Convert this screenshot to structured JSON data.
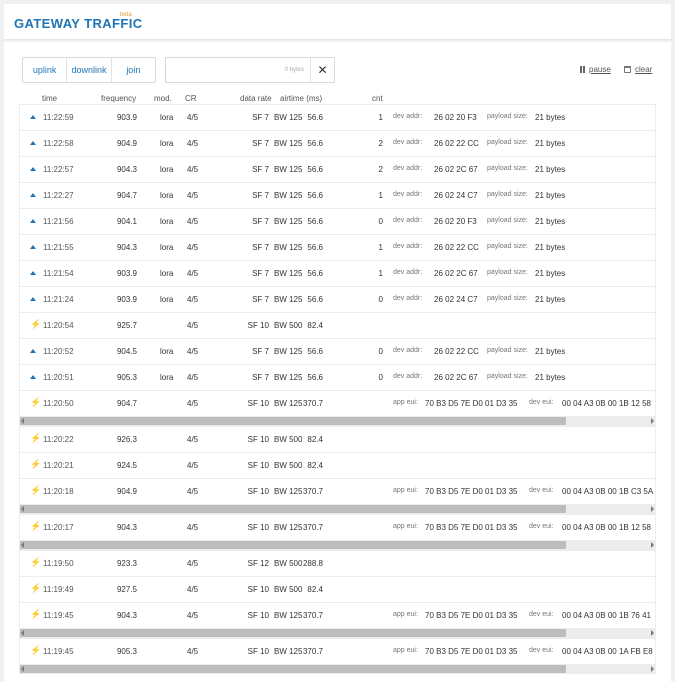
{
  "header": {
    "title": "GATEWAY TRAFFIC",
    "badge": "beta"
  },
  "filters": [
    "uplink",
    "downlink",
    "join"
  ],
  "search": {
    "value": "",
    "size_label": "0 bytes",
    "clear_symbol": "✕"
  },
  "actions": {
    "pause": "pause",
    "clear": "clear"
  },
  "columns": {
    "time": "time",
    "frequency": "frequency",
    "mod": "mod.",
    "cr": "CR",
    "data_rate": "data rate",
    "airtime": "airtime (ms)",
    "cnt": "cnt"
  },
  "labels": {
    "dev_addr": "dev addr:",
    "payload_size": "payload size:",
    "app_eui": "app eui:",
    "dev_eui": "dev eui:"
  },
  "icons": {
    "uplink": "uplink-arrow-icon",
    "downlink": "lightning-bolt-icon",
    "join": "lightning-bolt-icon"
  },
  "colors": {
    "accent": "#1d75b8",
    "downlink": "#5fd35f",
    "join": "#f0b030"
  },
  "rows": [
    {
      "kind": "uplink",
      "time": "11:22:59",
      "frequency": "903.9",
      "mod": "lora",
      "cr": "4/5",
      "sf": "SF 7",
      "bw": "BW 125",
      "airtime": "56.6",
      "cnt": "1",
      "dev_addr": "26 02 20 F3",
      "payload_size": "21 bytes"
    },
    {
      "kind": "uplink",
      "time": "11:22:58",
      "frequency": "904.9",
      "mod": "lora",
      "cr": "4/5",
      "sf": "SF 7",
      "bw": "BW 125",
      "airtime": "56.6",
      "cnt": "2",
      "dev_addr": "26 02 22 CC",
      "payload_size": "21 bytes"
    },
    {
      "kind": "uplink",
      "time": "11:22:57",
      "frequency": "904.3",
      "mod": "lora",
      "cr": "4/5",
      "sf": "SF 7",
      "bw": "BW 125",
      "airtime": "56.6",
      "cnt": "2",
      "dev_addr": "26 02 2C 67",
      "payload_size": "21 bytes"
    },
    {
      "kind": "uplink",
      "time": "11:22:27",
      "frequency": "904.7",
      "mod": "lora",
      "cr": "4/5",
      "sf": "SF 7",
      "bw": "BW 125",
      "airtime": "56.6",
      "cnt": "1",
      "dev_addr": "26 02 24 C7",
      "payload_size": "21 bytes"
    },
    {
      "kind": "uplink",
      "time": "11:21:56",
      "frequency": "904.1",
      "mod": "lora",
      "cr": "4/5",
      "sf": "SF 7",
      "bw": "BW 125",
      "airtime": "56.6",
      "cnt": "0",
      "dev_addr": "26 02 20 F3",
      "payload_size": "21 bytes"
    },
    {
      "kind": "uplink",
      "time": "11:21:55",
      "frequency": "904.3",
      "mod": "lora",
      "cr": "4/5",
      "sf": "SF 7",
      "bw": "BW 125",
      "airtime": "56.6",
      "cnt": "1",
      "dev_addr": "26 02 22 CC",
      "payload_size": "21 bytes"
    },
    {
      "kind": "uplink",
      "time": "11:21:54",
      "frequency": "903.9",
      "mod": "lora",
      "cr": "4/5",
      "sf": "SF 7",
      "bw": "BW 125",
      "airtime": "56.6",
      "cnt": "1",
      "dev_addr": "26 02 2C 67",
      "payload_size": "21 bytes"
    },
    {
      "kind": "uplink",
      "time": "11:21:24",
      "frequency": "903.9",
      "mod": "lora",
      "cr": "4/5",
      "sf": "SF 7",
      "bw": "BW 125",
      "airtime": "56.6",
      "cnt": "0",
      "dev_addr": "26 02 24 C7",
      "payload_size": "21 bytes"
    },
    {
      "kind": "downlink",
      "time": "11:20:54",
      "frequency": "925.7",
      "mod": "",
      "cr": "4/5",
      "sf": "SF 10",
      "bw": "BW 500",
      "airtime": "82.4"
    },
    {
      "kind": "uplink",
      "time": "11:20:52",
      "frequency": "904.5",
      "mod": "lora",
      "cr": "4/5",
      "sf": "SF 7",
      "bw": "BW 125",
      "airtime": "56.6",
      "cnt": "0",
      "dev_addr": "26 02 22 CC",
      "payload_size": "21 bytes"
    },
    {
      "kind": "uplink",
      "time": "11:20:51",
      "frequency": "905.3",
      "mod": "lora",
      "cr": "4/5",
      "sf": "SF 7",
      "bw": "BW 125",
      "airtime": "56.6",
      "cnt": "0",
      "dev_addr": "26 02 2C 67",
      "payload_size": "21 bytes"
    },
    {
      "kind": "join",
      "time": "11:20:50",
      "frequency": "904.7",
      "mod": "",
      "cr": "4/5",
      "sf": "SF 10",
      "bw": "BW 125",
      "airtime": "370.7",
      "app_eui": "70 B3 D5 7E D0 01 D3 35",
      "dev_eui": "00 04 A3 0B 00 1B 12 58"
    },
    {
      "kind": "downlink",
      "time": "11:20:22",
      "frequency": "926.3",
      "mod": "",
      "cr": "4/5",
      "sf": "SF 10",
      "bw": "BW 500",
      "airtime": "82.4"
    },
    {
      "kind": "downlink",
      "time": "11:20:21",
      "frequency": "924.5",
      "mod": "",
      "cr": "4/5",
      "sf": "SF 10",
      "bw": "BW 500",
      "airtime": "82.4"
    },
    {
      "kind": "join",
      "time": "11:20:18",
      "frequency": "904.9",
      "mod": "",
      "cr": "4/5",
      "sf": "SF 10",
      "bw": "BW 125",
      "airtime": "370.7",
      "app_eui": "70 B3 D5 7E D0 01 D3 35",
      "dev_eui": "00 04 A3 0B 00 1B C3 5A"
    },
    {
      "kind": "join",
      "time": "11:20:17",
      "frequency": "904.3",
      "mod": "",
      "cr": "4/5",
      "sf": "SF 10",
      "bw": "BW 125",
      "airtime": "370.7",
      "app_eui": "70 B3 D5 7E D0 01 D3 35",
      "dev_eui": "00 04 A3 0B 00 1B 12 58"
    },
    {
      "kind": "downlink",
      "time": "11:19:50",
      "frequency": "923.3",
      "mod": "",
      "cr": "4/5",
      "sf": "SF 12",
      "bw": "BW 500",
      "airtime": "288.8"
    },
    {
      "kind": "downlink",
      "time": "11:19:49",
      "frequency": "927.5",
      "mod": "",
      "cr": "4/5",
      "sf": "SF 10",
      "bw": "BW 500",
      "airtime": "82.4"
    },
    {
      "kind": "join",
      "time": "11:19:45",
      "frequency": "904.3",
      "mod": "",
      "cr": "4/5",
      "sf": "SF 10",
      "bw": "BW 125",
      "airtime": "370.7",
      "app_eui": "70 B3 D5 7E D0 01 D3 35",
      "dev_eui": "00 04 A3 0B 00 1B 76 41"
    },
    {
      "kind": "join",
      "time": "11:19:45",
      "frequency": "905.3",
      "mod": "",
      "cr": "4/5",
      "sf": "SF 10",
      "bw": "BW 125",
      "airtime": "370.7",
      "app_eui": "70 B3 D5 7E D0 01 D3 35",
      "dev_eui": "00 04 A3 0B 00 1A FB E8"
    }
  ]
}
